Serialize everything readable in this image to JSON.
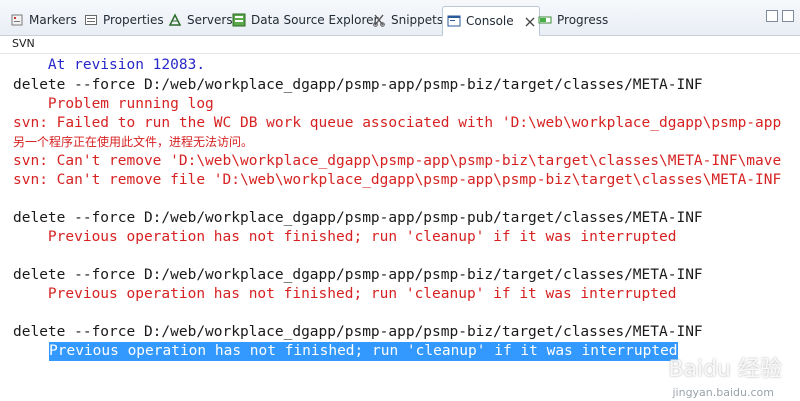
{
  "tabs": [
    {
      "label": "Markers",
      "icon": "markers-icon"
    },
    {
      "label": "Properties",
      "icon": "properties-icon"
    },
    {
      "label": "Servers",
      "icon": "servers-icon"
    },
    {
      "label": "Data Source Explorer",
      "icon": "data-source-icon"
    },
    {
      "label": "Snippets",
      "icon": "snippets-icon"
    },
    {
      "label": "Console",
      "icon": "console-icon",
      "active": true
    },
    {
      "label": "Progress",
      "icon": "progress-icon"
    }
  ],
  "console_header": "SVN",
  "console_lines": [
    "    At revision 12083.",
    "delete --force D:/web/workplace_dgapp/psmp-app/psmp-biz/target/classes/META-INF",
    "    Problem running log",
    "svn: Failed to run the WC DB work queue associated with 'D:\\web\\workplace_dgapp\\psmp-app",
    "另一个程序正在使用此文件，进程无法访问。",
    "svn: Can't remove 'D:\\web\\workplace_dgapp\\psmp-app\\psmp-biz\\target\\classes\\META-INF\\mave",
    "svn: Can't remove file 'D:\\web\\workplace_dgapp\\psmp-app\\psmp-biz\\target\\classes\\META-INF",
    "delete --force D:/web/workplace_dgapp/psmp-app/psmp-pub/target/classes/META-INF",
    "    Previous operation has not finished; run 'cleanup' if it was interrupted",
    "delete --force D:/web/workplace_dgapp/psmp-app/psmp-biz/target/classes/META-INF",
    "    Previous operation has not finished; run 'cleanup' if it was interrupted",
    "delete --force D:/web/workplace_dgapp/psmp-app/psmp-biz/target/classes/META-INF",
    "Previous operation has not finished; run 'cleanup' if it was interrupted"
  ],
  "watermark": "Baidu 经验",
  "watermark_url": "jingyan.baidu.com",
  "colors": {
    "info": "#2828c8",
    "error": "#d62222",
    "command": "#1a1a1a",
    "selection": "#3399ff"
  }
}
